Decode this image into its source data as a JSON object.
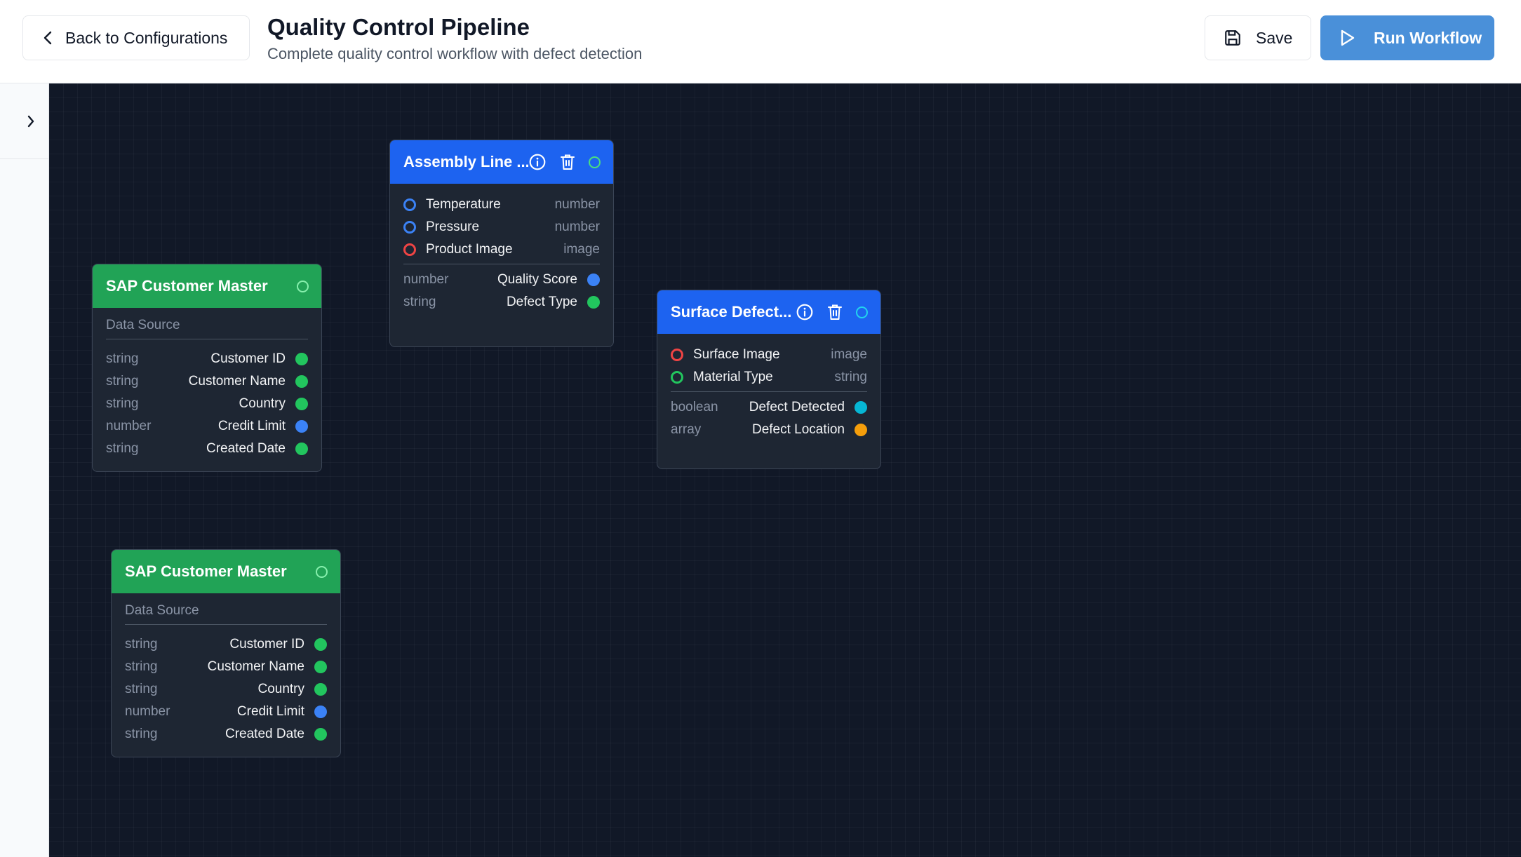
{
  "header": {
    "back_label": "Back to Configurations",
    "title": "Quality Control Pipeline",
    "subtitle": "Complete quality control workflow with defect detection",
    "save_label": "Save",
    "run_label": "Run Workflow"
  },
  "sidebar": {
    "toggle_icon": "chevron-right-icon"
  },
  "nodes": {
    "sap1": {
      "title": "SAP Customer Master",
      "category": "Data Source",
      "outputs": [
        {
          "type": "string",
          "label": "Customer ID"
        },
        {
          "type": "string",
          "label": "Customer Name"
        },
        {
          "type": "string",
          "label": "Country"
        },
        {
          "type": "number",
          "label": "Credit Limit"
        },
        {
          "type": "string",
          "label": "Created Date"
        }
      ]
    },
    "sap2": {
      "title": "SAP Customer Master",
      "category": "Data Source",
      "outputs": [
        {
          "type": "string",
          "label": "Customer ID"
        },
        {
          "type": "string",
          "label": "Customer Name"
        },
        {
          "type": "string",
          "label": "Country"
        },
        {
          "type": "number",
          "label": "Credit Limit"
        },
        {
          "type": "string",
          "label": "Created Date"
        }
      ]
    },
    "assembly": {
      "title": "Assembly Line ...",
      "inputs": [
        {
          "label": "Temperature",
          "type": "number"
        },
        {
          "label": "Pressure",
          "type": "number"
        },
        {
          "label": "Product Image",
          "type": "image"
        }
      ],
      "outputs": [
        {
          "type": "number",
          "label": "Quality Score"
        },
        {
          "type": "string",
          "label": "Defect Type"
        }
      ]
    },
    "surface": {
      "title": "Surface Defect...",
      "inputs": [
        {
          "label": "Surface Image",
          "type": "image"
        },
        {
          "label": "Material Type",
          "type": "string"
        }
      ],
      "outputs": [
        {
          "type": "boolean",
          "label": "Defect Detected"
        },
        {
          "type": "array",
          "label": "Defect Location"
        }
      ]
    }
  },
  "colors": {
    "string": "#22c55e",
    "number": "#3b82f6",
    "image": "#ef4444",
    "boolean": "#06b6d4",
    "array": "#f59e0b",
    "source_header": "#21a356",
    "processor_header": "#1d63f0",
    "canvas": "#111827"
  }
}
